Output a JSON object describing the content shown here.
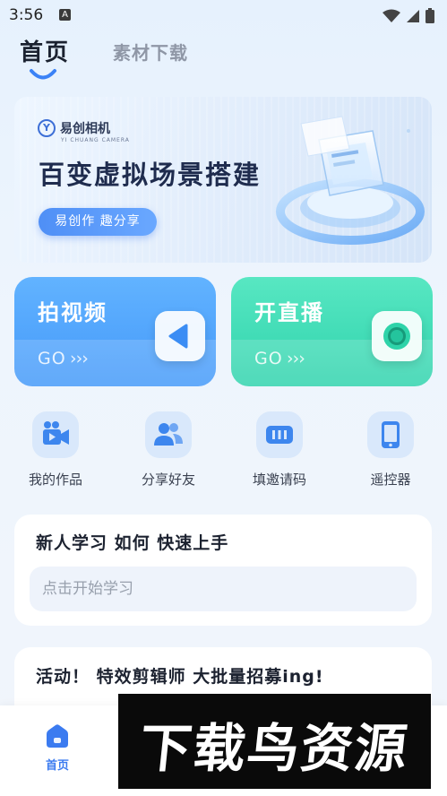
{
  "status_bar": {
    "time": "3:56",
    "notification_glyph": "A"
  },
  "tabs": [
    {
      "label": "首页",
      "selected": true
    },
    {
      "label": "素材下载",
      "selected": false
    }
  ],
  "banner": {
    "logo_text": "易创相机",
    "logo_sub": "YI CHUANG CAMERA",
    "title": "百变虚拟场景搭建",
    "button_label": "易创作 趣分享"
  },
  "actions": [
    {
      "title": "拍视频",
      "go": "GO",
      "arrows": "›››",
      "icon": "play-icon",
      "color": "#4499fa"
    },
    {
      "title": "开直播",
      "go": "GO",
      "arrows": "›››",
      "icon": "record-icon",
      "color": "#2fd3ad"
    }
  ],
  "quick_items": [
    {
      "label": "我的作品",
      "icon": "video-camera-icon"
    },
    {
      "label": "分享好友",
      "icon": "users-icon"
    },
    {
      "label": "填邀请码",
      "icon": "code-icon"
    },
    {
      "label": "遥控器",
      "icon": "phone-remote-icon"
    }
  ],
  "learn": {
    "title": "新人学习 如何 快速上手",
    "placeholder": "点击开始学习"
  },
  "activity": {
    "title": "活动！ 特效剪辑师 大批量招募ing!"
  },
  "bottom_nav": {
    "home_label": "首页",
    "accent": "#3b7bf0"
  },
  "watermark": {
    "text": "下载鸟资源"
  }
}
